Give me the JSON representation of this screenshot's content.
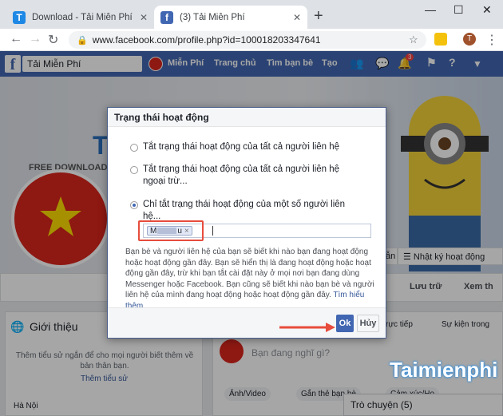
{
  "browser": {
    "tabs": [
      {
        "title": "Download - Tải Miễn Phí VN - Ph",
        "favicon": "T"
      },
      {
        "title": "(3) Tải Miễn Phí",
        "favicon": "f"
      }
    ],
    "url": "www.facebook.com/profile.php?id=100018203347641",
    "profile_initial": "T"
  },
  "facebook": {
    "search_value": "Tải Miễn Phí",
    "nav": {
      "profile": "Miễn Phí",
      "home": "Trang chủ",
      "find_friends": "Tìm bạn bè",
      "create": "Tạo"
    },
    "notification_count": "3",
    "cover_text": "FREE DOWNLOAD",
    "cover_letter": "T",
    "buttons": {
      "activity_log": "Nhật ký hoạt động",
      "save": "Lưu trữ",
      "see_more": "Xem th",
      "friends_partial": "ẫn",
      "continue_partial": "rực tiếp",
      "live_events": "Sự kiện trong"
    },
    "intro": {
      "title": "Giới thiệu",
      "body": "Thêm tiểu sử ngắn để cho mọi người biết thêm về bản thân bạn.",
      "add_bio": "Thêm tiểu sử",
      "location": "Hà Nội"
    },
    "composer": {
      "placeholder": "Bạn đang nghĩ gì?",
      "photo": "Ảnh/Video",
      "tag": "Gắn thẻ bạn bè",
      "feeling": "Cảm xúc/Ho"
    },
    "chat": "Trò chuyện (5)"
  },
  "dialog": {
    "title": "Trạng thái hoạt động",
    "options": [
      "Tắt trạng thái hoạt động của tất cả người liên hệ",
      "Tắt trạng thái hoạt động của tất cả người liên hệ ngoại trừ...",
      "Chỉ tắt trạng thái hoạt động của một số người liên hệ..."
    ],
    "selected_option": 2,
    "token": "M",
    "token_tail": "u",
    "description": "Bạn bè và người liên hệ của bạn sẽ biết khi nào bạn đang hoạt động hoặc hoạt động gần đây. Bạn sẽ hiển thị là đang hoạt động hoặc hoạt động gần đây, trừ khi bạn tắt cài đặt này ở mọi nơi bạn đang dùng Messenger hoặc Facebook. Bạn cũng sẽ biết khi nào bạn bè và người liên hệ của mình đang hoạt động hoặc hoạt động gần đây.",
    "learn_more": "Tìm hiểu thêm",
    "ok_label": "Ok",
    "cancel_label": "Hủy"
  },
  "watermark": "Taimienphi",
  "colors": {
    "facebook_blue": "#4267b2",
    "highlight": "#e74c3c",
    "vn_red": "#da251d",
    "vn_yellow": "#ffde00"
  }
}
